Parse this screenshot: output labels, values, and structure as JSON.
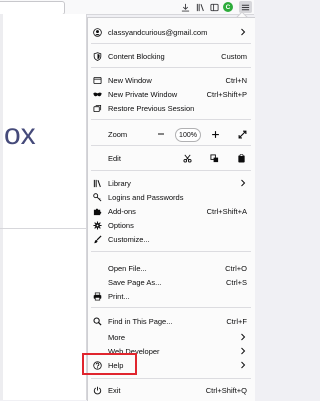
{
  "background": {
    "page_word": "ox"
  },
  "menu": {
    "account_email": "classyandcurious@gmail.com",
    "content_blocking": {
      "label": "Content Blocking",
      "value": "Custom"
    },
    "window_items": [
      {
        "label": "New Window",
        "shortcut": "Ctrl+N"
      },
      {
        "label": "New Private Window",
        "shortcut": "Ctrl+Shift+P"
      },
      {
        "label": "Restore Previous Session",
        "shortcut": ""
      }
    ],
    "zoom": {
      "label": "Zoom",
      "value": "100%"
    },
    "edit": {
      "label": "Edit"
    },
    "library_items": [
      {
        "label": "Library",
        "shortcut": ""
      },
      {
        "label": "Logins and Passwords",
        "shortcut": ""
      },
      {
        "label": "Add-ons",
        "shortcut": "Ctrl+Shift+A"
      },
      {
        "label": "Options",
        "shortcut": ""
      },
      {
        "label": "Customize...",
        "shortcut": ""
      }
    ],
    "file_items": [
      {
        "label": "Open File...",
        "shortcut": "Ctrl+O"
      },
      {
        "label": "Save Page As...",
        "shortcut": "Ctrl+S"
      },
      {
        "label": "Print...",
        "shortcut": ""
      }
    ],
    "tool_items": [
      {
        "label": "Find in This Page...",
        "shortcut": "Ctrl+F"
      },
      {
        "label": "More",
        "shortcut": ""
      },
      {
        "label": "Web Developer",
        "shortcut": ""
      },
      {
        "label": "Help",
        "shortcut": ""
      }
    ],
    "exit": {
      "label": "Exit",
      "shortcut": "Ctrl+Shift+Q"
    }
  },
  "toolbar": {
    "avatar_letter": "C"
  },
  "colors": {
    "highlight_box": "#e0252e",
    "panel_bg": "#fbfbfb"
  }
}
